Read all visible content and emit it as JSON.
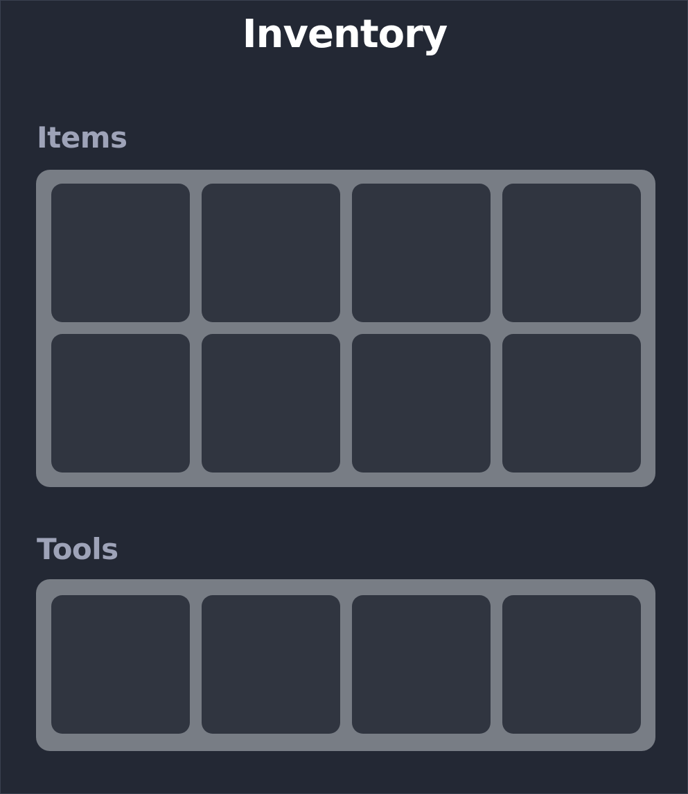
{
  "title": "Inventory",
  "sections": {
    "items": {
      "label": "Items",
      "slots": [
        "",
        "",
        "",
        "",
        "",
        "",
        "",
        ""
      ]
    },
    "tools": {
      "label": "Tools",
      "slots": [
        "",
        "",
        "",
        ""
      ]
    }
  },
  "colors": {
    "background": "#232834",
    "title": "#ffffff",
    "section_label": "#9ea3b8",
    "grid_frame": "#787d85",
    "slot": "#303540"
  }
}
